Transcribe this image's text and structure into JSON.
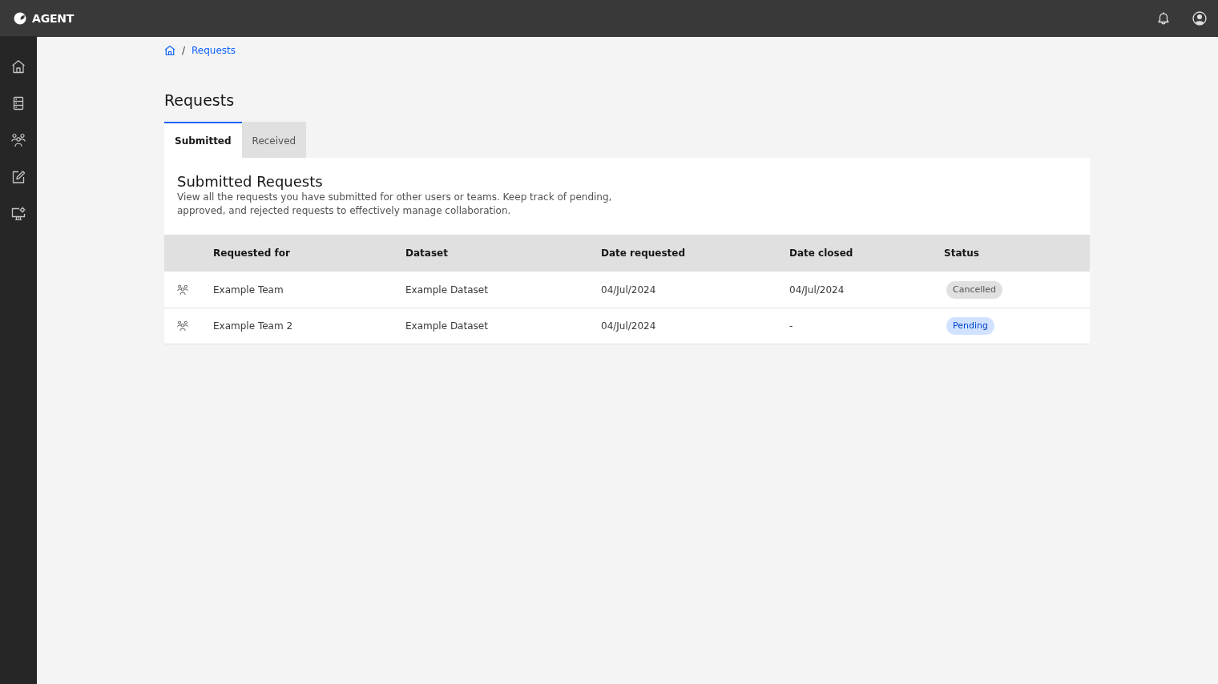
{
  "header": {
    "brand": "AGENT"
  },
  "breadcrumb": {
    "separator": "/",
    "items": [
      {
        "label": "Requests"
      }
    ]
  },
  "page_title": "Requests",
  "tabs": [
    {
      "label": "Submitted",
      "selected": true
    },
    {
      "label": "Received",
      "selected": false
    }
  ],
  "panel": {
    "title": "Submitted Requests",
    "description": "View all the requests you have submitted for other users or teams. Keep track of pending, approved, and rejected requests to effectively manage collaboration."
  },
  "table": {
    "columns": [
      "Requested for",
      "Dataset",
      "Date requested",
      "Date closed",
      "Status"
    ],
    "rows": [
      {
        "kind": "team",
        "requested_for": "Example Team",
        "dataset": "Example Dataset",
        "date_requested": "04/Jul/2024",
        "date_closed": "04/Jul/2024",
        "status": {
          "label": "Cancelled",
          "kind": "cancelled"
        }
      },
      {
        "kind": "team",
        "requested_for": "Example Team 2",
        "dataset": "Example Dataset",
        "date_requested": "04/Jul/2024",
        "date_closed": "-",
        "status": {
          "label": "Pending",
          "kind": "pending"
        }
      }
    ]
  }
}
